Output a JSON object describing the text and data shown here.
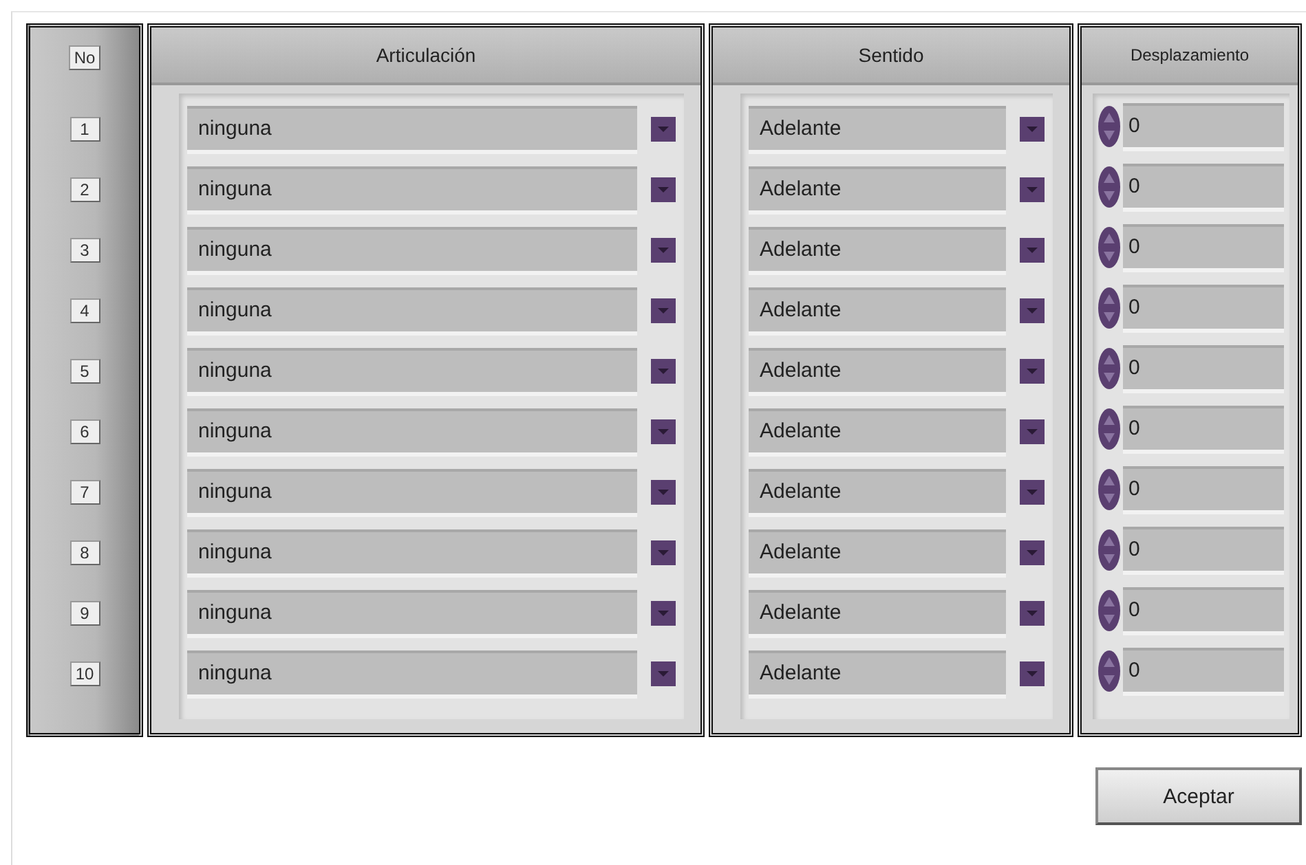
{
  "columns": [
    "No",
    "Articulación",
    "Sentido",
    "Desplazamiento"
  ],
  "rows": [
    {
      "no": "1",
      "articulacion": "ninguna",
      "sentido": "Adelante",
      "desplazamiento": "0"
    },
    {
      "no": "2",
      "articulacion": "ninguna",
      "sentido": "Adelante",
      "desplazamiento": "0"
    },
    {
      "no": "3",
      "articulacion": "ninguna",
      "sentido": "Adelante",
      "desplazamiento": "0"
    },
    {
      "no": "4",
      "articulacion": "ninguna",
      "sentido": "Adelante",
      "desplazamiento": "0"
    },
    {
      "no": "5",
      "articulacion": "ninguna",
      "sentido": "Adelante",
      "desplazamiento": "0"
    },
    {
      "no": "6",
      "articulacion": "ninguna",
      "sentido": "Adelante",
      "desplazamiento": "0"
    },
    {
      "no": "7",
      "articulacion": "ninguna",
      "sentido": "Adelante",
      "desplazamiento": "0"
    },
    {
      "no": "8",
      "articulacion": "ninguna",
      "sentido": "Adelante",
      "desplazamiento": "0"
    },
    {
      "no": "9",
      "articulacion": "ninguna",
      "sentido": "Adelante",
      "desplazamiento": "0"
    },
    {
      "no": "10",
      "articulacion": "ninguna",
      "sentido": "Adelante",
      "desplazamiento": "0"
    }
  ],
  "accept_button": "Aceptar"
}
